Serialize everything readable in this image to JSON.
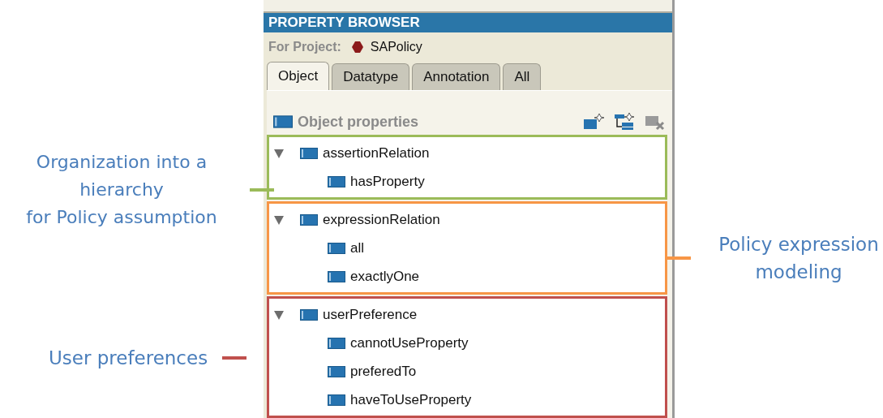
{
  "panel": {
    "title": "PROPERTY BROWSER",
    "project_label": "For Project:",
    "project_name": "SAPolicy"
  },
  "tabs": [
    {
      "label": "Object",
      "selected": true
    },
    {
      "label": "Datatype",
      "selected": false
    },
    {
      "label": "Annotation",
      "selected": false
    },
    {
      "label": "All",
      "selected": false
    }
  ],
  "section": {
    "title": "Object properties"
  },
  "groups": [
    {
      "color": "#9bbb59",
      "annotation": {
        "kind": "left",
        "text": "Organization into a\nhierarchy\nfor Policy assumption"
      },
      "node": {
        "label": "assertionRelation",
        "expanded": true,
        "children": [
          {
            "label": "hasProperty"
          }
        ]
      }
    },
    {
      "color": "#f79646",
      "annotation": {
        "kind": "right",
        "text": "Policy expression modeling"
      },
      "node": {
        "label": "expressionRelation",
        "expanded": true,
        "children": [
          {
            "label": "all"
          },
          {
            "label": "exactlyOne"
          }
        ]
      }
    },
    {
      "color": "#c0504d",
      "annotation": {
        "kind": "left",
        "text": "User preferences"
      },
      "node": {
        "label": "userPreference",
        "expanded": true,
        "children": [
          {
            "label": "cannotUseProperty"
          },
          {
            "label": "preferedTo"
          },
          {
            "label": "haveToUseProperty"
          }
        ]
      }
    }
  ]
}
